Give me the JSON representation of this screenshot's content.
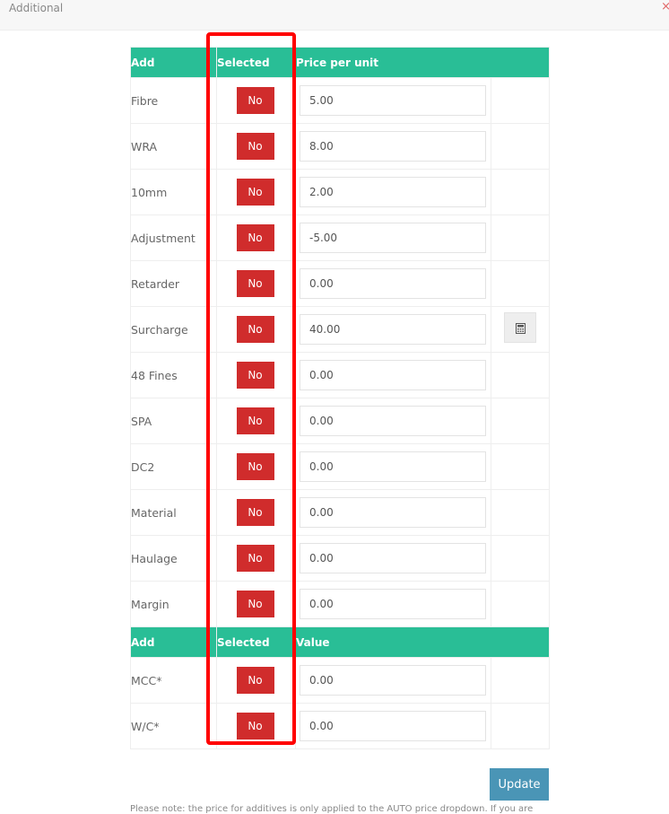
{
  "window": {
    "title": "Additional",
    "close_symbol": "×"
  },
  "table1": {
    "headers": [
      "Add",
      "Selected",
      "Price per unit"
    ],
    "rows": [
      {
        "label": "Fibre",
        "selected": "No",
        "price": "5.00"
      },
      {
        "label": "WRA",
        "selected": "No",
        "price": "8.00"
      },
      {
        "label": "10mm",
        "selected": "No",
        "price": "2.00"
      },
      {
        "label": "Adjustment",
        "selected": "No",
        "price": "-5.00"
      },
      {
        "label": "Retarder",
        "selected": "No",
        "price": "0.00"
      },
      {
        "label": "Surcharge",
        "selected": "No",
        "price": "40.00",
        "has_calculator": true
      },
      {
        "label": "48 Fines",
        "selected": "No",
        "price": "0.00"
      },
      {
        "label": "SPA",
        "selected": "No",
        "price": "0.00"
      },
      {
        "label": "DC2",
        "selected": "No",
        "price": "0.00"
      },
      {
        "label": "Material",
        "selected": "No",
        "price": "0.00"
      },
      {
        "label": "Haulage",
        "selected": "No",
        "price": "0.00"
      },
      {
        "label": "Margin",
        "selected": "No",
        "price": "0.00"
      }
    ]
  },
  "table2": {
    "headers": [
      "Add",
      "Selected",
      "Value"
    ],
    "rows": [
      {
        "label": "MCC*",
        "selected": "No",
        "price": "0.00"
      },
      {
        "label": "W/C*",
        "selected": "No",
        "price": "0.00"
      }
    ]
  },
  "icons": {
    "calculator": "calculator-icon"
  },
  "colors": {
    "header": "#29be96",
    "no_button": "#d02c2c",
    "update_button": "#4a95b6",
    "highlight": "#ff0000"
  },
  "update_label": "Update",
  "note": "Please note: the price for additives is only applied to the AUTO price dropdown. If you are"
}
